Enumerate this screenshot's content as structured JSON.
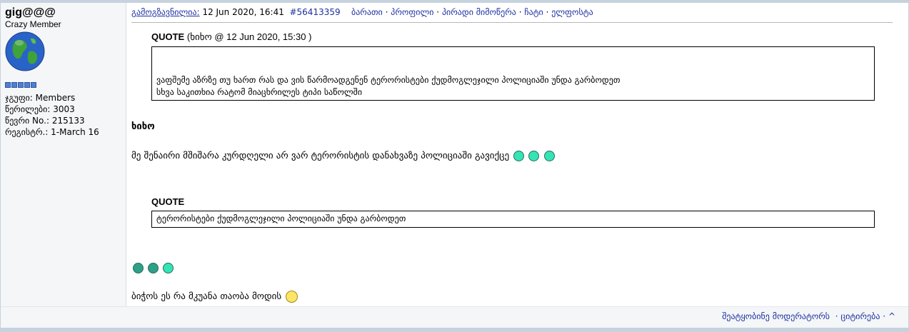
{
  "author": {
    "username": "gig@@@",
    "rank": "Crazy Member",
    "pips": 5,
    "stats": [
      "ჯგუფი: Members",
      "წერილები: 3003",
      "წევრი No.: 215133",
      "რეგისტრ.: 1-March 16"
    ]
  },
  "post": {
    "posted_label": "გამოგზავნილია:",
    "date": "12 Jun 2020, 16:41",
    "post_number": "#56413359",
    "links": [
      "ბარათი",
      "პროფილი",
      "პირადი მიმოწერა",
      "ჩატი",
      "ელფოსტა"
    ],
    "separator": "·"
  },
  "quote1": {
    "label": "QUOTE",
    "meta": "(ხიხო @ 12 Jun 2020, 15:30 )",
    "lines": [
      "ვაფშემე აზრზე თუ ხართ რას და ვის წარმოადგენენ ტერორისტები ქუდმოგლეჯილი პოლიციაში უნდა გარბოდეთ",
      "სხვა საკითხია რატომ მიაცხრილეს ტიპი საწოლში"
    ]
  },
  "reply_name": "ხიხო",
  "reply_text": "მე შენაირი მშიშარა კურდღელი არ ვარ ტერორისტის დანახვაზე პოლიციაში გავიქცე",
  "quote2": {
    "label": "QUOTE",
    "text": "ტერორისტები ქუდმოგლეჯილი პოლიციაში უნდა გარბოდეთ"
  },
  "closing_text": "ბიჭოს ეს რა მკუანა თაობა მოდის",
  "footer": {
    "report": "შეატყობინე მოდერატორს",
    "quote": "ციტირება",
    "top": "^"
  },
  "colors": {
    "border": "#c6d2dd",
    "sidebar": "#f4f6f8",
    "link": "#1c2fa0",
    "smiley": "#33e5b5"
  }
}
